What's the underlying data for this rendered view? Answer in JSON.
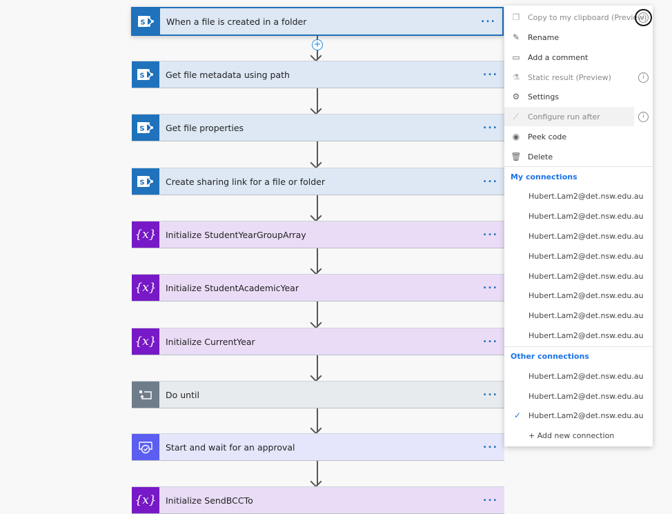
{
  "flow": {
    "steps": [
      {
        "label": "When a file is created in a folder",
        "type": "sharepoint",
        "icon": "sharepoint-icon",
        "more": "..."
      },
      {
        "label": "Get file metadata using path",
        "type": "sharepoint",
        "icon": "sharepoint-icon",
        "more": "..."
      },
      {
        "label": "Get file properties",
        "type": "sharepoint",
        "icon": "sharepoint-icon",
        "more": "..."
      },
      {
        "label": "Create sharing link for a file or folder",
        "type": "sharepoint",
        "icon": "sharepoint-icon",
        "more": "..."
      },
      {
        "label": "Initialize StudentYearGroupArray",
        "type": "variable",
        "icon": "variable-icon",
        "more": "..."
      },
      {
        "label": "Initialize StudentAcademicYear",
        "type": "variable",
        "icon": "variable-icon",
        "more": "..."
      },
      {
        "label": "Initialize CurrentYear",
        "type": "variable",
        "icon": "variable-icon",
        "more": "..."
      },
      {
        "label": "Do until",
        "type": "loop",
        "icon": "loop-icon",
        "more": "..."
      },
      {
        "label": "Start and wait for an approval",
        "type": "approval",
        "icon": "approval-icon",
        "more": "..."
      },
      {
        "label": "Initialize SendBCCTo",
        "type": "variable",
        "icon": "variable-icon",
        "more": "..."
      }
    ],
    "variable_glyph": "{x}",
    "add_step_glyph": "+"
  },
  "menu": {
    "items": [
      {
        "label": "Copy to my clipboard (Preview)",
        "icon": "copy-icon",
        "disabled": true,
        "info": true
      },
      {
        "label": "Rename",
        "icon": "pencil-icon"
      },
      {
        "label": "Add a comment",
        "icon": "comment-icon"
      },
      {
        "label": "Static result (Preview)",
        "icon": "flask-icon",
        "disabled": true,
        "info": true
      },
      {
        "label": "Settings",
        "icon": "gear-icon"
      },
      {
        "label": "Configure run after",
        "icon": "run-after-icon",
        "disabled": true,
        "info": true
      },
      {
        "label": "Peek code",
        "icon": "eye-icon"
      },
      {
        "label": "Delete",
        "icon": "trash-icon"
      }
    ],
    "my_connections_title": "My connections",
    "my_connections": [
      "Hubert.Lam2@det.nsw.edu.au",
      "Hubert.Lam2@det.nsw.edu.au",
      "Hubert.Lam2@det.nsw.edu.au",
      "Hubert.Lam2@det.nsw.edu.au",
      "Hubert.Lam2@det.nsw.edu.au",
      "Hubert.Lam2@det.nsw.edu.au",
      "Hubert.Lam2@det.nsw.edu.au",
      "Hubert.Lam2@det.nsw.edu.au"
    ],
    "other_connections_title": "Other connections",
    "other_connections": [
      {
        "label": "Hubert.Lam2@det.nsw.edu.au",
        "selected": false
      },
      {
        "label": "Hubert.Lam2@det.nsw.edu.au",
        "selected": false
      },
      {
        "label": "Hubert.Lam2@det.nsw.edu.au",
        "selected": true
      }
    ],
    "add_connection": "+ Add new connection",
    "info_glyph": "i",
    "check_glyph": "✓"
  },
  "colors": {
    "sharepoint": "#1f72bb",
    "variable": "#7719c6",
    "loop": "#6f7d8b",
    "approval": "#5b5ef0",
    "accent": "#1a73e8"
  }
}
